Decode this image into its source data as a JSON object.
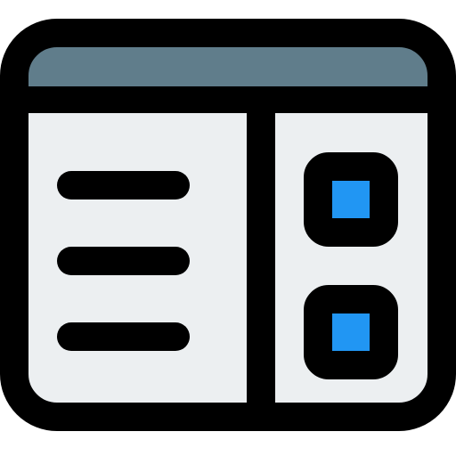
{
  "icon": {
    "name": "browser-window-layout-icon",
    "colors": {
      "outline": "#000000",
      "title_bar": "#607D8B",
      "panel_fill": "#ECEFF1",
      "accent": "#2196F3"
    },
    "content_lines_count": 3,
    "checkbox_count": 2
  }
}
